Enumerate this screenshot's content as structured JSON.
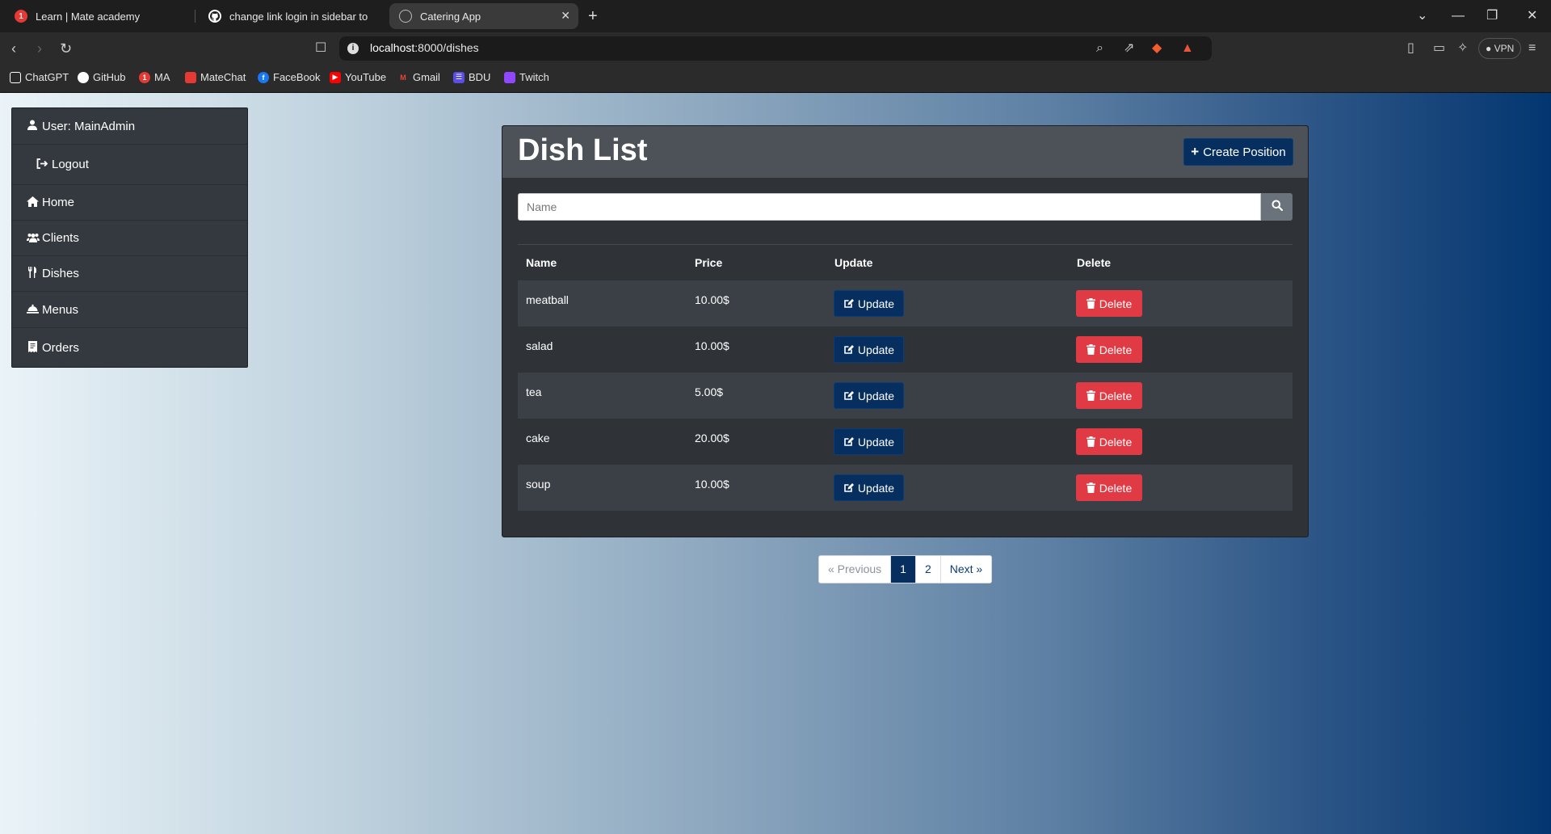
{
  "browser": {
    "tabs": [
      {
        "title": "Learn | Mate academy",
        "favicon": "mate-academy-icon",
        "badge": "1"
      },
      {
        "title": "change link login in sidebar to avoid",
        "favicon": "github-icon"
      },
      {
        "title": "Catering App",
        "favicon": "globe-icon",
        "active": true
      }
    ],
    "url_host": "localhost",
    "url_path": ":8000/dishes",
    "vpn_label": "VPN",
    "bookmarks": [
      {
        "label": "ChatGPT",
        "icon": "chatgpt-icon",
        "color": "#ffffff"
      },
      {
        "label": "GitHub",
        "icon": "github-icon",
        "color": "#ffffff"
      },
      {
        "label": "MA",
        "icon": "mate-academy-icon",
        "color": "#e53935",
        "badge": "1"
      },
      {
        "label": "MateChat",
        "icon": "matechat-icon",
        "color": "#e53935"
      },
      {
        "label": "FaceBook",
        "icon": "facebook-icon",
        "color": "#1877f2"
      },
      {
        "label": "YouTube",
        "icon": "youtube-icon",
        "color": "#ff0000"
      },
      {
        "label": "Gmail",
        "icon": "gmail-icon",
        "color": "#ea4335"
      },
      {
        "label": "BDU",
        "icon": "bdu-icon",
        "color": "#5c4ee5"
      },
      {
        "label": "Twitch",
        "icon": "twitch-icon",
        "color": "#9146ff"
      }
    ]
  },
  "sidebar": {
    "user_label": "User: MainAdmin",
    "logout_label": "Logout",
    "items": [
      {
        "label": "Home",
        "icon": "home-icon"
      },
      {
        "label": "Clients",
        "icon": "users-icon"
      },
      {
        "label": "Dishes",
        "icon": "utensils-icon"
      },
      {
        "label": "Menus",
        "icon": "cloche-icon"
      },
      {
        "label": "Orders",
        "icon": "receipt-icon"
      }
    ]
  },
  "main": {
    "title": "Dish List",
    "create_label": "Create Position",
    "search_placeholder": "Name",
    "table": {
      "headers": [
        "Name",
        "Price",
        "Update",
        "Delete"
      ],
      "rows": [
        {
          "name": "meatball",
          "price": "10.00$"
        },
        {
          "name": "salad",
          "price": "10.00$"
        },
        {
          "name": "tea",
          "price": "5.00$"
        },
        {
          "name": "cake",
          "price": "20.00$"
        },
        {
          "name": "soup",
          "price": "10.00$"
        }
      ],
      "update_label": "Update",
      "delete_label": "Delete"
    },
    "pagination": {
      "previous_label": "« Previous",
      "pages": [
        "1",
        "2"
      ],
      "current_page": "1",
      "next_label": "Next »"
    }
  },
  "colors": {
    "primary": "#062f5f",
    "danger": "#e03a45",
    "card_bg": "#2f3338",
    "card_header_bg": "#4d5259"
  }
}
